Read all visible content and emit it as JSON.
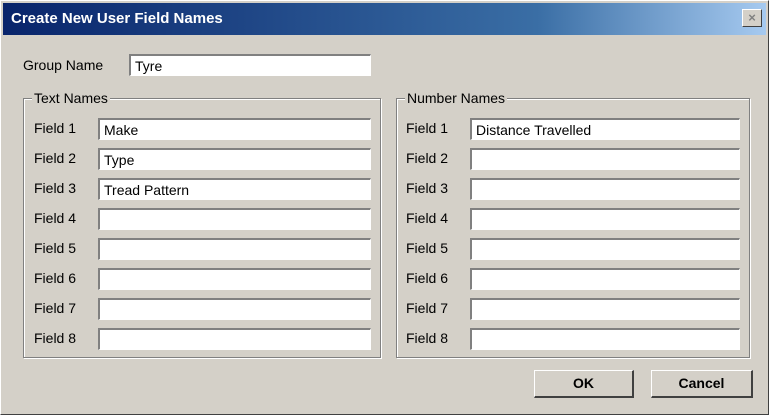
{
  "window": {
    "title": "Create New User Field Names",
    "close_glyph": "×"
  },
  "group": {
    "label": "Group Name",
    "value": "Tyre"
  },
  "text_names": {
    "legend": "Text Names",
    "fields": [
      {
        "label": "Field 1",
        "value": "Make"
      },
      {
        "label": "Field 2",
        "value": "Type"
      },
      {
        "label": "Field 3",
        "value": "Tread Pattern"
      },
      {
        "label": "Field 4",
        "value": ""
      },
      {
        "label": "Field 5",
        "value": ""
      },
      {
        "label": "Field 6",
        "value": ""
      },
      {
        "label": "Field 7",
        "value": ""
      },
      {
        "label": "Field 8",
        "value": ""
      }
    ]
  },
  "number_names": {
    "legend": "Number Names",
    "fields": [
      {
        "label": "Field 1",
        "value": "Distance Travelled"
      },
      {
        "label": "Field 2",
        "value": ""
      },
      {
        "label": "Field 3",
        "value": ""
      },
      {
        "label": "Field 4",
        "value": ""
      },
      {
        "label": "Field 5",
        "value": ""
      },
      {
        "label": "Field 6",
        "value": ""
      },
      {
        "label": "Field 7",
        "value": ""
      },
      {
        "label": "Field 8",
        "value": ""
      }
    ]
  },
  "buttons": {
    "ok": "OK",
    "cancel": "Cancel"
  },
  "colors": {
    "titlebar_start": "#08246b",
    "face": "#d4d0c8"
  }
}
